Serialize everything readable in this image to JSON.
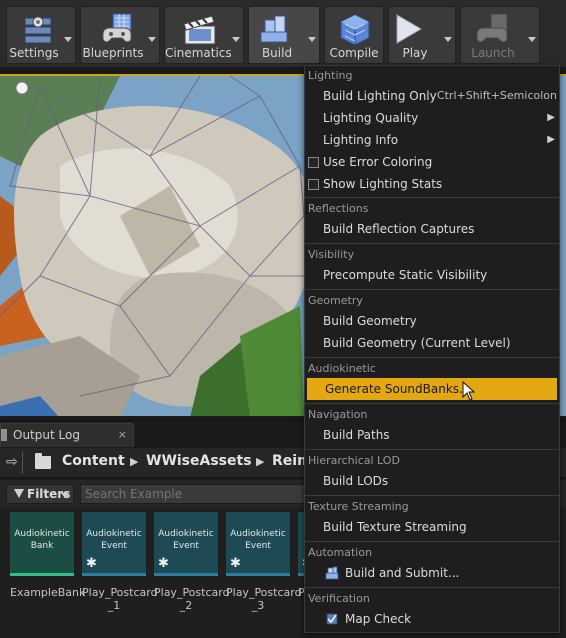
{
  "toolbar": {
    "buttons": [
      {
        "label": "Settings"
      },
      {
        "label": "Blueprints"
      },
      {
        "label": "Cinematics"
      },
      {
        "label": "Build"
      },
      {
        "label": "Compile"
      },
      {
        "label": "Play"
      },
      {
        "label": "Launch"
      }
    ]
  },
  "menu": {
    "sections": {
      "lighting": "Lighting",
      "reflections": "Reflections",
      "visibility": "Visibility",
      "geometry": "Geometry",
      "audiokinetic": "Audiokinetic",
      "navigation": "Navigation",
      "hlod": "Hierarchical LOD",
      "texture_streaming": "Texture Streaming",
      "automation": "Automation",
      "verification": "Verification"
    },
    "items": {
      "build_lighting_only": "Build Lighting Only",
      "build_lighting_only_shortcut": "Ctrl+Shift+Semicolon",
      "lighting_quality": "Lighting Quality",
      "lighting_info": "Lighting Info",
      "use_error_coloring": "Use Error Coloring",
      "show_lighting_stats": "Show Lighting Stats",
      "build_reflection_captures": "Build Reflection Captures",
      "precompute_static_visibility": "Precompute Static Visibility",
      "build_geometry": "Build Geometry",
      "build_geometry_current": "Build Geometry (Current Level)",
      "generate_soundbanks": "Generate SoundBanks...",
      "build_paths": "Build Paths",
      "build_lods": "Build LODs",
      "build_texture_streaming": "Build Texture Streaming",
      "build_and_submit": "Build and Submit...",
      "map_check": "Map Check"
    },
    "submenu_glyph": "▶"
  },
  "output_log": {
    "tab_label": "Output Log",
    "close_glyph": "×"
  },
  "path": {
    "back_glyph": "⇨",
    "crumbs": [
      "Content",
      "WWiseAssets",
      "Reim"
    ],
    "crumb_sep": "▶"
  },
  "filters": {
    "label": "Filters",
    "search_placeholder": "Search Example"
  },
  "assets": [
    {
      "thumb": "Audiokinetic Bank",
      "name": "ExampleBank"
    },
    {
      "thumb": "Audiokinetic Event",
      "name": "Play_Postcard _1"
    },
    {
      "thumb": "Audiokinetic Event",
      "name": "Play_Postcard _2"
    },
    {
      "thumb": "Audiokinetic Event",
      "name": "Play_Postcard _3"
    },
    {
      "thumb": "",
      "name": "Pl"
    }
  ],
  "asset_star": "✱",
  "colors": {
    "highlight": "#e3a712",
    "viewport_border": "#c9a227"
  }
}
